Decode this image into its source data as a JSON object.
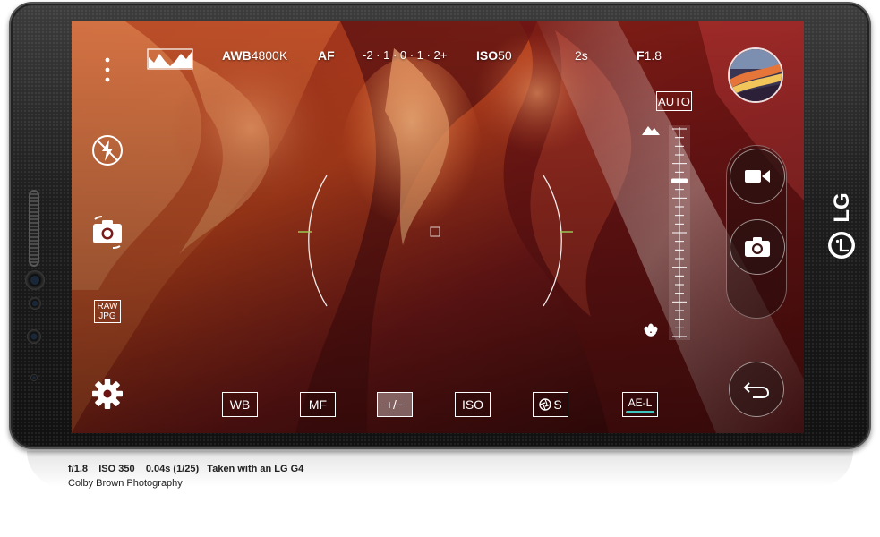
{
  "top_bar": {
    "histogram_icon": "histogram-icon",
    "awb_label": "AWB",
    "awb_value": "4800K",
    "af_label": "AF",
    "ev_scale": "-2 · 1 · 0 · 1 · 2+",
    "iso_label": "ISO",
    "iso_value": "50",
    "shutter": "2s",
    "aperture_label": "F",
    "aperture_value": "1.8"
  },
  "left_controls": {
    "menu_icon": "more-vert-icon",
    "flash_icon": "flash-off-icon",
    "switch_camera_icon": "switch-camera-icon",
    "raw_label_top": "RAW",
    "raw_label_bottom": "JPG",
    "settings_icon": "gear-icon"
  },
  "bottom_controls": {
    "wb": "WB",
    "mf": "MF",
    "ev": "+/−",
    "iso": "ISO",
    "shutter_suffix": "S",
    "ae_lock": "AE-L"
  },
  "focus": {
    "auto_label": "AUTO",
    "far_icon": "mountain-icon",
    "near_icon": "macro-flower-icon",
    "level": 0.25
  },
  "right_controls": {
    "gallery_icon": "gallery-thumbnail",
    "video_icon": "video-camera-icon",
    "photo_icon": "camera-icon",
    "back_icon": "back-arrow-icon"
  },
  "device": {
    "brand": "LG"
  },
  "caption": {
    "line1": "f/1.8    ISO 350    0.04s (1/25)   Taken with an LG G4",
    "line2": "Colby Brown Photography"
  },
  "colors": {
    "accent_teal": "#3fc7bf",
    "focus_green": "#9ed35a"
  }
}
